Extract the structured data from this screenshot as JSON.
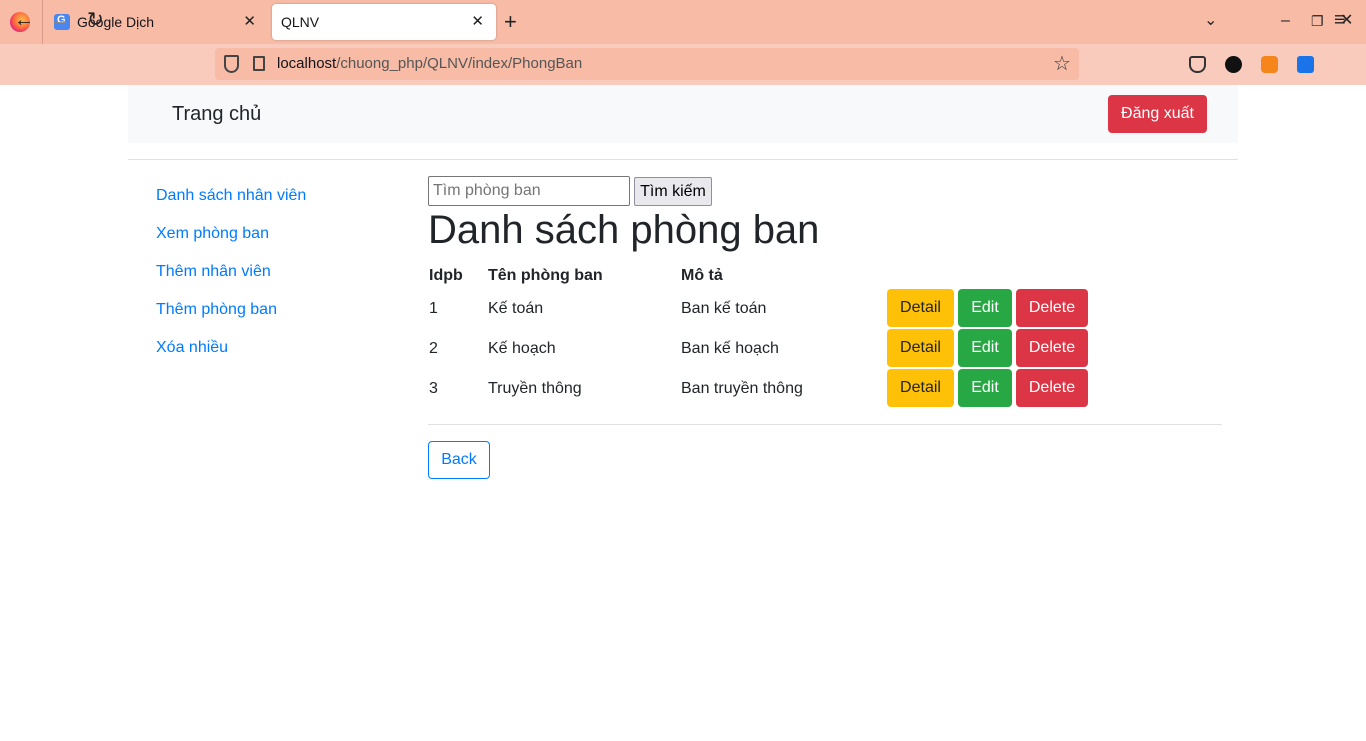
{
  "browser": {
    "tabs": [
      {
        "title": "Google Dịch"
      },
      {
        "title": "QLNV"
      }
    ],
    "url": {
      "host": "localhost",
      "path": "/chuong_php/QLNV/index/PhongBan"
    }
  },
  "header": {
    "brand": "Trang chủ",
    "logout_label": "Đăng xuất"
  },
  "sidebar": {
    "items": [
      {
        "label": "Danh sách nhân viên"
      },
      {
        "label": "Xem phòng ban"
      },
      {
        "label": "Thêm nhân viên"
      },
      {
        "label": "Thêm phòng ban"
      },
      {
        "label": "Xóa nhiều"
      }
    ]
  },
  "search": {
    "placeholder": "Tìm phòng ban",
    "button_label": "Tìm kiếm"
  },
  "main": {
    "title": "Danh sách phòng ban",
    "columns": [
      "Idpb",
      "Tên phòng ban",
      "Mô tả"
    ],
    "rows": [
      {
        "id": "1",
        "name": "Kế toán",
        "desc": "Ban kế toán"
      },
      {
        "id": "2",
        "name": "Kế hoạch",
        "desc": "Ban kế hoạch"
      },
      {
        "id": "3",
        "name": "Truyền thông",
        "desc": "Ban truyền thông"
      }
    ],
    "actions": {
      "detail": "Detail",
      "edit": "Edit",
      "delete": "Delete"
    },
    "back_label": "Back"
  },
  "colors": {
    "primary": "#007bff",
    "danger": "#dc3545",
    "warning": "#ffc107",
    "success": "#28a745"
  }
}
